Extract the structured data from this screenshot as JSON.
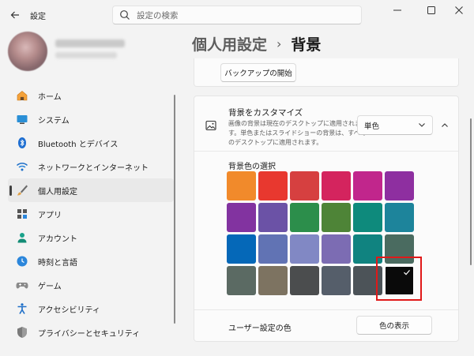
{
  "titlebar": {
    "back_icon": "back-arrow-icon",
    "title": "設定",
    "search_placeholder": "設定の検索",
    "controls": [
      "minimize-icon",
      "maximize-icon",
      "close-icon"
    ]
  },
  "sidebar": {
    "items": [
      {
        "label": "ホーム",
        "icon": "home-icon"
      },
      {
        "label": "システム",
        "icon": "system-icon"
      },
      {
        "label": "Bluetooth とデバイス",
        "icon": "bluetooth-icon"
      },
      {
        "label": "ネットワークとインターネット",
        "icon": "wifi-icon"
      },
      {
        "label": "個人用設定",
        "icon": "brush-icon",
        "active": true
      },
      {
        "label": "アプリ",
        "icon": "apps-icon"
      },
      {
        "label": "アカウント",
        "icon": "account-icon"
      },
      {
        "label": "時刻と言語",
        "icon": "globe-clock-icon"
      },
      {
        "label": "ゲーム",
        "icon": "gamepad-icon"
      },
      {
        "label": "アクセシビリティ",
        "icon": "accessibility-icon"
      },
      {
        "label": "プライバシーとセキュリティ",
        "icon": "shield-icon"
      }
    ]
  },
  "breadcrumb": {
    "parent": "個人用設定",
    "separator": "›",
    "current": "背景"
  },
  "backup": {
    "button_label": "バックアップの開始"
  },
  "customize": {
    "title": "背景をカスタマイズ",
    "description": "画像の背景は現在のデスクトップに適用されます。単色またはスライドショーの背景は、すべてのデスクトップに適用されます。",
    "select_value": "単色",
    "palette_label": "背景色の選択",
    "colors": [
      "#f18a2b",
      "#e8382f",
      "#d64040",
      "#d4245e",
      "#c1268c",
      "#8e2fa0",
      "#8233a0",
      "#6b52a6",
      "#2c8e4b",
      "#4e8437",
      "#0e8a7c",
      "#1d849b",
      "#0568b8",
      "#6173b4",
      "#8188c4",
      "#7c6cb3",
      "#108380",
      "#4a6b60",
      "#5b6a63",
      "#7d7361",
      "#4b4d4e",
      "#555e6a",
      "#4c5358",
      "#0a0a0a"
    ],
    "selected_index": 23,
    "custom_label": "ユーザー設定の色",
    "view_colors_label": "色の表示"
  }
}
